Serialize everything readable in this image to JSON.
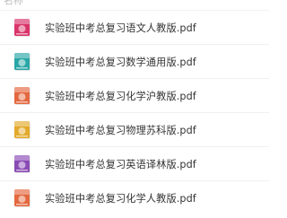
{
  "header": {
    "column_label": "名称"
  },
  "files": [
    {
      "name": "实验班中考总复习语文人教版.pdf",
      "thumb_color": "#d9346a",
      "thumb_icon": "book-cover-icon"
    },
    {
      "name": "实验班中考总复习数学通用版.pdf",
      "thumb_color": "#2aa6a6",
      "thumb_icon": "book-cover-icon"
    },
    {
      "name": "实验班中考总复习化学沪教版.pdf",
      "thumb_color": "#e4683f",
      "thumb_icon": "book-cover-icon"
    },
    {
      "name": "实验班中考总复习物理苏科版.pdf",
      "thumb_color": "#e2a92a",
      "thumb_icon": "book-cover-icon"
    },
    {
      "name": "实验班中考总复习英语译林版.pdf",
      "thumb_color": "#8a4bb5",
      "thumb_icon": "book-cover-icon"
    },
    {
      "name": "实验班中考总复习化学人教版.pdf",
      "thumb_color": "#e4683f",
      "thumb_icon": "book-cover-icon"
    }
  ]
}
